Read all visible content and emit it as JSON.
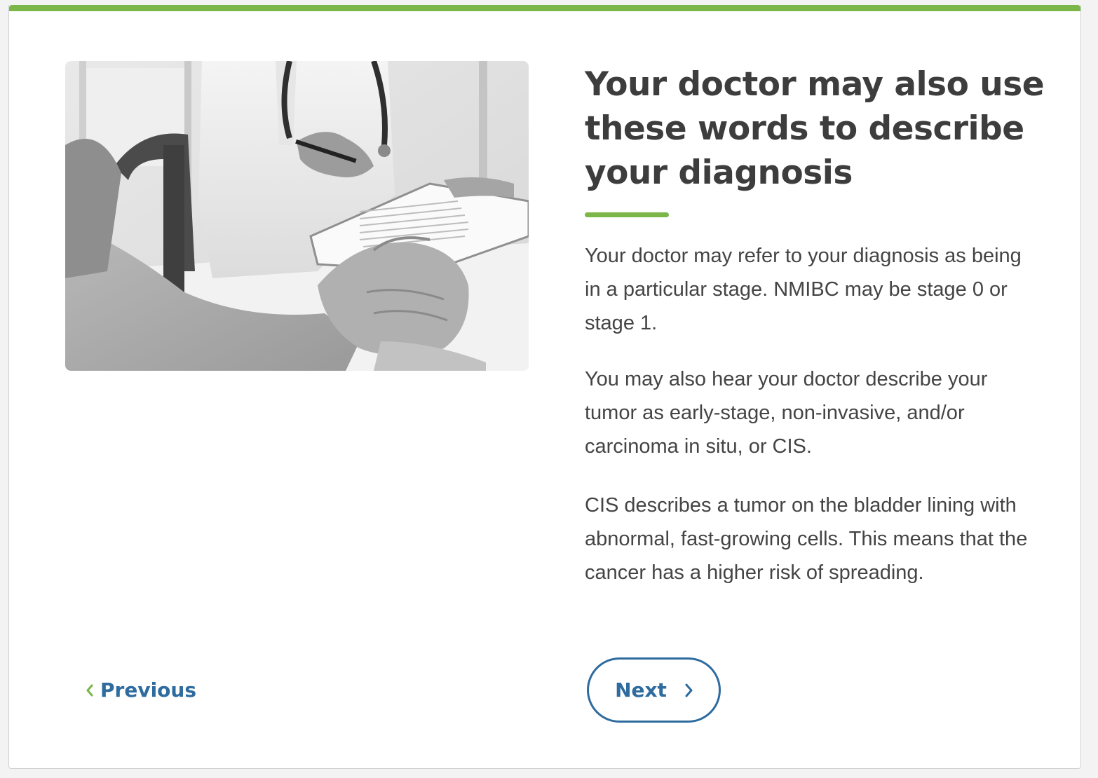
{
  "colors": {
    "accent_green": "#7ab648",
    "link_blue": "#2e6b9e",
    "heading_text": "#3d3d3d",
    "body_text": "#444444"
  },
  "image": {
    "icon": "doctor-consultation-photo"
  },
  "content": {
    "heading": "Your doctor may also use these words to describe your diagnosis",
    "paragraphs": [
      "Your doctor may refer to your diagnosis as being in a particular stage. NMIBC may be stage 0 or stage 1.",
      "You may also hear your doctor describe your tumor as early-stage, non-invasive, and/or carcinoma in situ, or CIS.",
      "CIS describes a tumor on the bladder lining with abnormal, fast-growing cells. This means that the cancer has a higher risk of spreading."
    ]
  },
  "navigation": {
    "previous_label": "Previous",
    "previous_icon": "chevron-left-icon",
    "next_label": "Next",
    "next_icon": "chevron-right-icon"
  }
}
